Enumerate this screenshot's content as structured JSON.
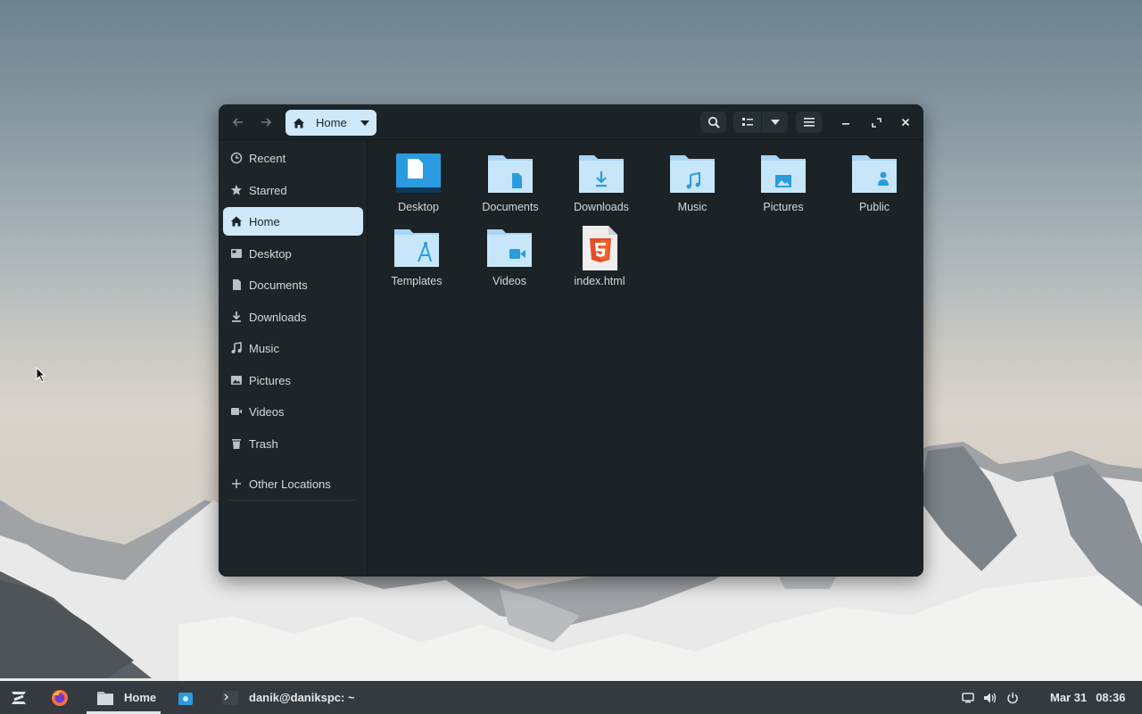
{
  "window": {
    "pathbar": {
      "label": "Home"
    },
    "sidebar": {
      "items": [
        {
          "label": "Recent",
          "icon": "clock-icon"
        },
        {
          "label": "Starred",
          "icon": "star-icon"
        },
        {
          "label": "Home",
          "icon": "home-icon",
          "active": true
        },
        {
          "label": "Desktop",
          "icon": "desktop-icon"
        },
        {
          "label": "Documents",
          "icon": "document-icon"
        },
        {
          "label": "Downloads",
          "icon": "download-icon"
        },
        {
          "label": "Music",
          "icon": "music-icon"
        },
        {
          "label": "Pictures",
          "icon": "picture-icon"
        },
        {
          "label": "Videos",
          "icon": "video-icon"
        },
        {
          "label": "Trash",
          "icon": "trash-icon"
        }
      ],
      "other_locations": "Other Locations"
    },
    "files": [
      {
        "name": "Desktop",
        "icon": "desktop-folder-icon"
      },
      {
        "name": "Documents",
        "icon": "documents-folder-icon"
      },
      {
        "name": "Downloads",
        "icon": "downloads-folder-icon"
      },
      {
        "name": "Music",
        "icon": "music-folder-icon"
      },
      {
        "name": "Pictures",
        "icon": "pictures-folder-icon"
      },
      {
        "name": "Public",
        "icon": "public-folder-icon"
      },
      {
        "name": "Templates",
        "icon": "templates-folder-icon"
      },
      {
        "name": "Videos",
        "icon": "videos-folder-icon"
      },
      {
        "name": "index.html",
        "icon": "html5-file-icon"
      }
    ]
  },
  "taskbar": {
    "files_app": "Home",
    "terminal": "danik@danikspc: ~",
    "date": "Mar 31",
    "time": "08:36"
  },
  "colors": {
    "accent": "#cfe9fb",
    "folder": "#c8e6fa",
    "folder_tab": "#a9d5f5",
    "folder_glyph": "#2a9be0",
    "window_bg": "#1b2327"
  }
}
